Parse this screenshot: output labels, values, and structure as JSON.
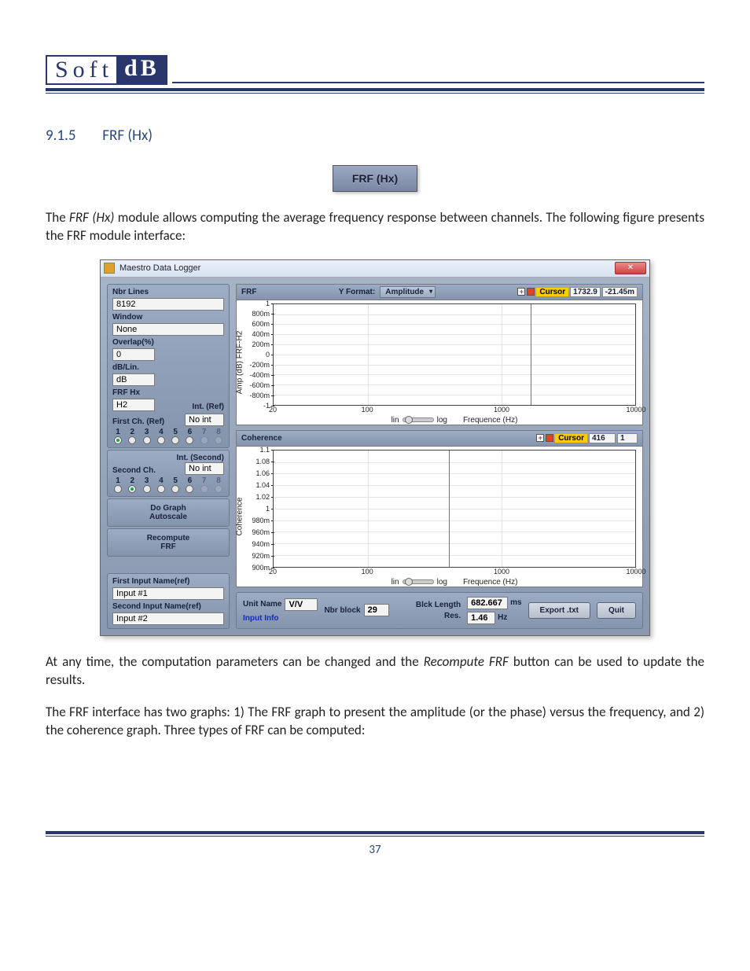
{
  "logo": {
    "soft": "Soft",
    "db": "dB"
  },
  "section": {
    "number": "9.1.5",
    "title": "FRF (Hx)"
  },
  "frf_button_label": "FRF (Hx)",
  "para1_a": "The ",
  "para1_em": "FRF (Hx)",
  "para1_b": " module allows computing the average frequency response between channels. The following figure presents the FRF module interface:",
  "para2_a": "At any time, the computation parameters can be changed and the ",
  "para2_em": "Recompute FRF",
  "para2_b": " button can be used to update the results.",
  "para3": "The FRF interface has two graphs: 1) The FRF graph to present the amplitude (or the phase) versus the frequency, and 2) the coherence graph. Three types of FRF can be computed:",
  "page_number": "37",
  "app": {
    "title": "Maestro Data Logger",
    "sidebar": {
      "nbr_lines_label": "Nbr Lines",
      "nbr_lines_value": "8192",
      "window_label": "Window",
      "window_value": "None",
      "overlap_label": "Overlap(%)",
      "overlap_value": "0",
      "dblin_label": "dB/Lin.",
      "dblin_value": "dB",
      "frfhx_label": "FRF Hx",
      "frfhx_value": "H2",
      "int_ref_label": "Int. (Ref)",
      "int_ref_value": "No int",
      "first_ch_label": "First Ch. (Ref)",
      "channels": [
        "1",
        "2",
        "3",
        "4",
        "5",
        "6",
        "7",
        "8"
      ],
      "int_second_label": "Int. (Second)",
      "int_second_value": "No int",
      "second_ch_label": "Second Ch.",
      "do_graph_label": "Do Graph\nAutoscale",
      "recompute_label": "Recompute\nFRF",
      "first_input_label": "First Input Name(ref)",
      "first_input_value": "Input #1",
      "second_input_label": "Second Input Name(ref)",
      "second_input_value": "Input #2"
    },
    "graph1": {
      "title": "FRF",
      "yformat_label": "Y Format:",
      "yformat_value": "Amplitude",
      "cursor_label": "Cursor",
      "cursor_x": "1732.9",
      "cursor_y": "-21.45m",
      "ylabel": "Amp (dB) FRF-H2",
      "lin_label": "lin",
      "log_label": "log",
      "xlabel": "Frequence (Hz)"
    },
    "graph2": {
      "title": "Coherence",
      "cursor_label": "Cursor",
      "cursor_x": "416",
      "cursor_y": "1",
      "ylabel": "Coherence",
      "lin_label": "lin",
      "log_label": "log",
      "xlabel": "Frequence (Hz)"
    },
    "bottom": {
      "unit_name_label": "Unit Name",
      "unit_name_value": "V/V",
      "input_info_label": "Input Info",
      "nbr_block_label": "Nbr block",
      "nbr_block_value": "29",
      "blck_len_label": "Blck Length",
      "blck_len_value": "682.667",
      "blck_len_unit": "ms",
      "res_label": "Res.",
      "res_value": "1.46",
      "res_unit": "Hz",
      "export_label": "Export .txt",
      "quit_label": "Quit"
    }
  },
  "chart_data": [
    {
      "type": "line",
      "title": "FRF",
      "xlabel": "Frequence (Hz)",
      "ylabel": "Amp (dB) FRF-H2",
      "xscale": "log",
      "xlim": [
        20,
        10000
      ],
      "ylim": [
        -1,
        1
      ],
      "yticks": [
        -1,
        -0.8,
        -0.6,
        -0.4,
        -0.2,
        0,
        0.2,
        0.4,
        0.6,
        0.8,
        1
      ],
      "ytick_labels": [
        "-1",
        "-800m",
        "-600m",
        "-400m",
        "-200m",
        "0",
        "200m",
        "400m",
        "600m",
        "800m",
        "1"
      ],
      "xticks": [
        20,
        100,
        1000,
        10000
      ],
      "cursor": {
        "x": 1732.9,
        "y": -0.02145
      },
      "series": [
        {
          "name": "FRF-H2",
          "x": [],
          "y": []
        }
      ]
    },
    {
      "type": "line",
      "title": "Coherence",
      "xlabel": "Frequence (Hz)",
      "ylabel": "Coherence",
      "xscale": "log",
      "xlim": [
        20,
        10000
      ],
      "ylim": [
        0.9,
        1.1
      ],
      "yticks": [
        0.9,
        0.92,
        0.94,
        0.96,
        0.98,
        1.0,
        1.02,
        1.04,
        1.06,
        1.08,
        1.1
      ],
      "ytick_labels": [
        "900m",
        "920m",
        "940m",
        "960m",
        "980m",
        "1",
        "1.02",
        "1.04",
        "1.06",
        "1.08",
        "1.1"
      ],
      "xticks": [
        20,
        100,
        1000,
        10000
      ],
      "cursor": {
        "x": 416,
        "y": 1
      },
      "series": [
        {
          "name": "Coherence",
          "x": [],
          "y": []
        }
      ]
    }
  ]
}
